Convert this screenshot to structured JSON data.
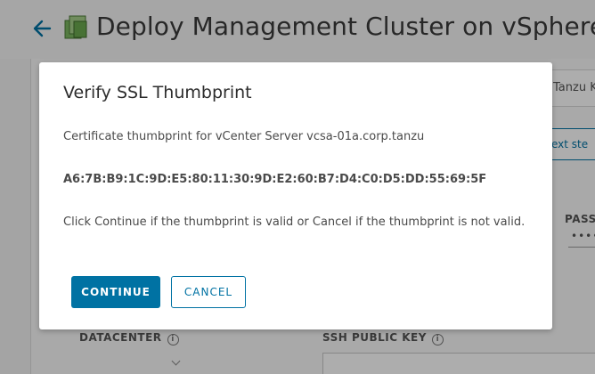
{
  "page": {
    "title": "Deploy Management Cluster on vSphere",
    "right_card_text": "Tanzu K",
    "next_button_text": "ext ste",
    "password_label": "PASS",
    "password_mask": "••••",
    "datacenter_label": "DATACENTER",
    "ssh_key_label": "SSH PUBLIC KEY"
  },
  "modal": {
    "title": "Verify SSL Thumbprint",
    "description": "Certificate thumbprint for vCenter Server vcsa-01a.corp.tanzu",
    "thumbprint": "A6:7B:B9:1C:9D:E5:80:11:30:9D:E2:60:B7:D4:C0:D5:DD:55:69:5F",
    "instruction": "Click Continue if the thumbprint is valid or Cancel if the thumbprint is not valid.",
    "continue_label": "CONTINUE",
    "cancel_label": "CANCEL"
  },
  "icons": {
    "back": "back-arrow-icon",
    "logo": "tanzu-logo-icon",
    "info": "info-icon",
    "dropdown": "chevron-down-icon"
  },
  "colors": {
    "primary": "#0072a3",
    "backdrop": "rgba(0,0,0,0.32)"
  }
}
